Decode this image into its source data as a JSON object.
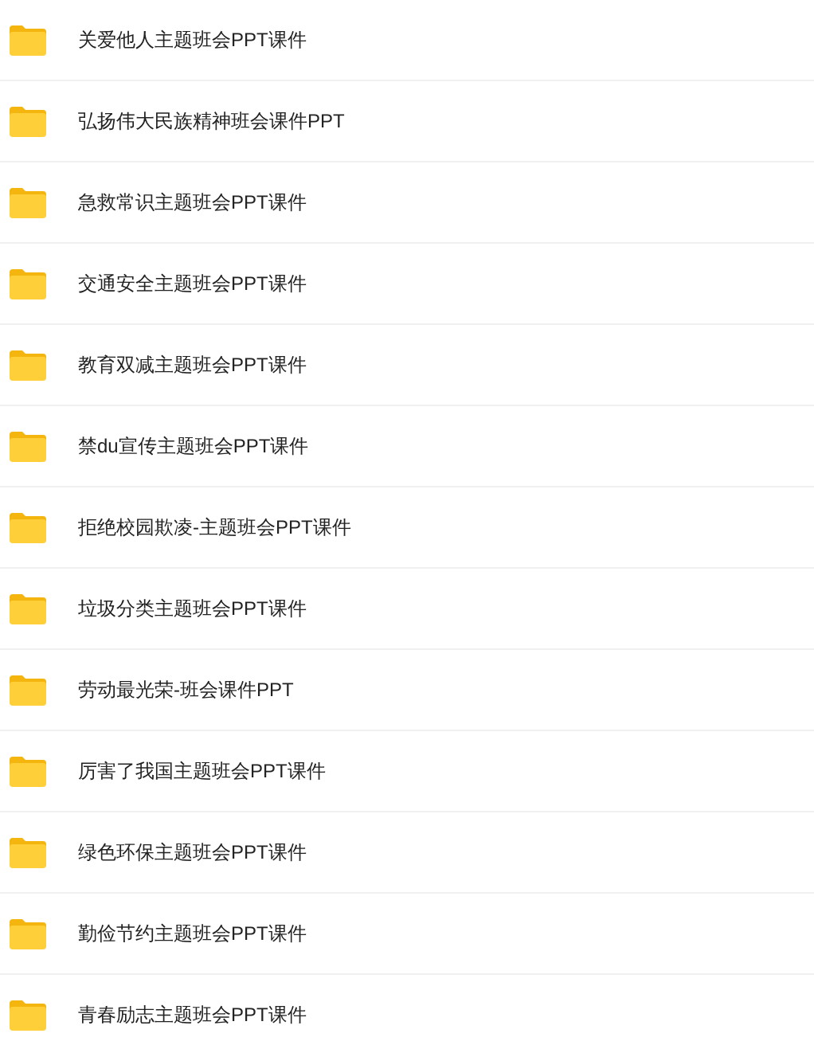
{
  "folders": [
    {
      "name": "关爱他人主题班会PPT课件"
    },
    {
      "name": "弘扬伟大民族精神班会课件PPT"
    },
    {
      "name": "急救常识主题班会PPT课件"
    },
    {
      "name": "交通安全主题班会PPT课件"
    },
    {
      "name": "教育双减主题班会PPT课件"
    },
    {
      "name": "禁du宣传主题班会PPT课件"
    },
    {
      "name": "拒绝校园欺凌-主题班会PPT课件"
    },
    {
      "name": "垃圾分类主题班会PPT课件"
    },
    {
      "name": "劳动最光荣-班会课件PPT"
    },
    {
      "name": "厉害了我国主题班会PPT课件"
    },
    {
      "name": "绿色环保主题班会PPT课件"
    },
    {
      "name": "勤俭节约主题班会PPT课件"
    },
    {
      "name": "青春励志主题班会PPT课件"
    }
  ]
}
